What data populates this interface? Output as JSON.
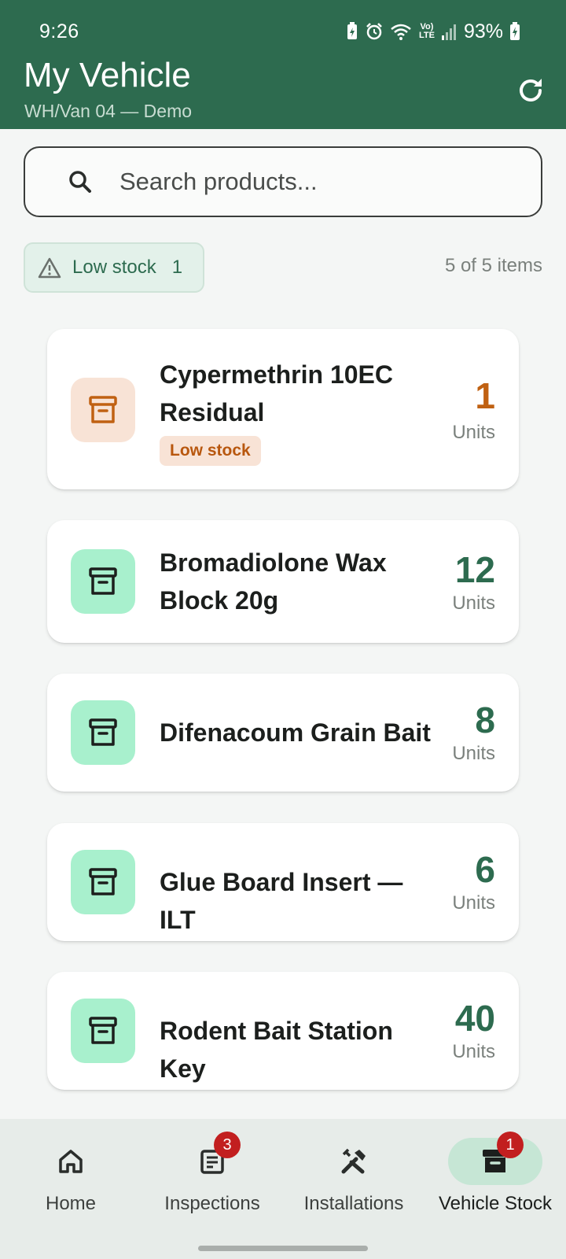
{
  "status_bar": {
    "time": "9:26",
    "battery": "93%",
    "network_label": "Vo) LTE"
  },
  "header": {
    "title": "My Vehicle",
    "subtitle": "WH/Van 04 — Demo"
  },
  "search": {
    "placeholder": "Search products..."
  },
  "filter": {
    "chip_label": "Low stock",
    "chip_count": "1",
    "items_count": "5 of 5 items"
  },
  "products": [
    {
      "name": "Cypermethrin 10EC Residual",
      "quantity": "1",
      "unit": "Units",
      "badge": "Low stock",
      "status": "low"
    },
    {
      "name": "Bromadiolone Wax Block 20g",
      "quantity": "12",
      "unit": "Units",
      "status": "ok"
    },
    {
      "name": "Difenacoum Grain Bait",
      "quantity": "8",
      "unit": "Units",
      "status": "ok"
    },
    {
      "name": "Glue Board Insert — ILT",
      "quantity": "6",
      "unit": "Units",
      "status": "ok"
    },
    {
      "name": "Rodent Bait Station Key",
      "quantity": "40",
      "unit": "Units",
      "status": "ok"
    }
  ],
  "nav": [
    {
      "label": "Home",
      "icon": "home-icon",
      "badge": null,
      "active": false
    },
    {
      "label": "Inspections",
      "icon": "clipboard-icon",
      "badge": "3",
      "active": false
    },
    {
      "label": "Installations",
      "icon": "tools-icon",
      "badge": null,
      "active": false
    },
    {
      "label": "Vehicle Stock",
      "icon": "archive-icon",
      "badge": "1",
      "active": true
    }
  ],
  "colors": {
    "header_bg": "#2d6b4f",
    "low_stock_accent": "#c06112",
    "ok_stock_accent": "#2d6b4f",
    "ok_icon_bg": "#a8f0cd",
    "low_icon_bg": "#f8e3d6",
    "badge_red": "#c21f1f"
  }
}
